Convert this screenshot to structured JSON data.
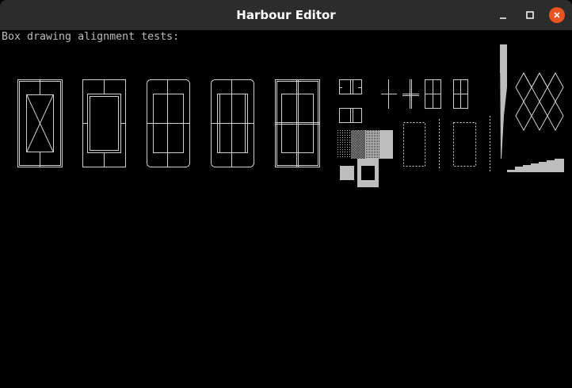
{
  "window": {
    "title": "Harbour Editor",
    "controls": {
      "minimize_icon": "minimize-icon",
      "maximize_icon": "maximize-icon",
      "close_icon": "close-icon",
      "close_color": "#e95420"
    },
    "titlebar_color": "#2c2c2c"
  },
  "terminal": {
    "background": "#000000",
    "foreground": "#bdbdbd",
    "line1": "Box drawing alignment tests:"
  }
}
